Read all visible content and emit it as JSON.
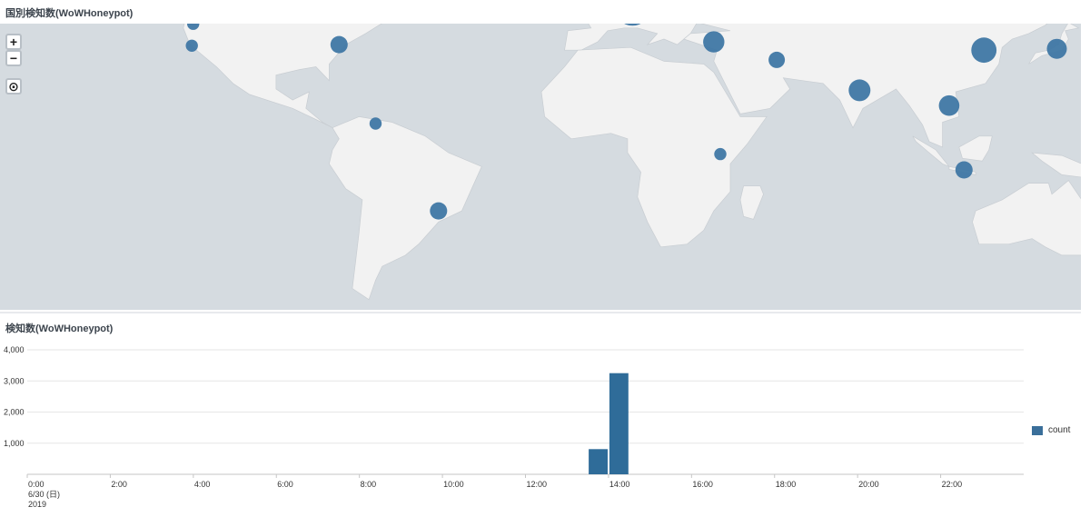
{
  "map_panel": {
    "title": "国別検知数(WoWHoneypot)",
    "zoom_in_label": "+",
    "zoom_out_label": "−",
    "locate_label": "⊙",
    "bubble_color": "#3f77a4",
    "ocean_color": "#d5dbe0",
    "land_color": "#f2f2f2",
    "bubbles": [
      {
        "lon": 10.5,
        "lat": 51.2,
        "weight": 1.0
      },
      {
        "lon": 116.5,
        "lat": 36.0,
        "weight": 0.42
      },
      {
        "lon": 138.5,
        "lat": 36.5,
        "weight": 0.22
      },
      {
        "lon": 79.0,
        "lat": 21.5,
        "weight": 0.28
      },
      {
        "lon": 35.0,
        "lat": 39.0,
        "weight": 0.26
      },
      {
        "lon": 106.0,
        "lat": 16.0,
        "weight": 0.24
      },
      {
        "lon": 54.0,
        "lat": 32.5,
        "weight": 0.12
      },
      {
        "lon": -78.0,
        "lat": 38.0,
        "weight": 0.14
      },
      {
        "lon": 110.5,
        "lat": -7.2,
        "weight": 0.14
      },
      {
        "lon": -48.0,
        "lat": -22.0,
        "weight": 0.14
      },
      {
        "lon": -122.0,
        "lat": 45.5,
        "weight": 0.04
      },
      {
        "lon": -122.4,
        "lat": 37.6,
        "weight": 0.04
      },
      {
        "lon": -67.0,
        "lat": 9.5,
        "weight": 0.04
      },
      {
        "lon": 37.0,
        "lat": -1.5,
        "weight": 0.04
      }
    ]
  },
  "chart_panel": {
    "title": "検知数(WoWHoneypot)",
    "legend_label": "count",
    "bar_color": "#2f6c99"
  },
  "chart_data": {
    "type": "bar",
    "title": "検知数(WoWHoneypot)",
    "x_tick_labels": [
      "0:00",
      "2:00",
      "4:00",
      "6:00",
      "8:00",
      "10:00",
      "12:00",
      "14:00",
      "16:00",
      "18:00",
      "20:00",
      "22:00"
    ],
    "x_first_date_label": "6/30 (日)",
    "x_first_year_label": "2019",
    "y_tick_labels": [
      "1,000",
      "2,000",
      "3,000",
      "4,000"
    ],
    "ylim": [
      0,
      4000
    ],
    "xlim_hours": [
      0,
      24
    ],
    "bin_hours": 0.5,
    "series": [
      {
        "name": "count",
        "bars": [
          {
            "start_hour": 13.5,
            "value": 810
          },
          {
            "start_hour": 14.0,
            "value": 3250
          }
        ]
      }
    ],
    "legend": "right",
    "grid": true
  }
}
